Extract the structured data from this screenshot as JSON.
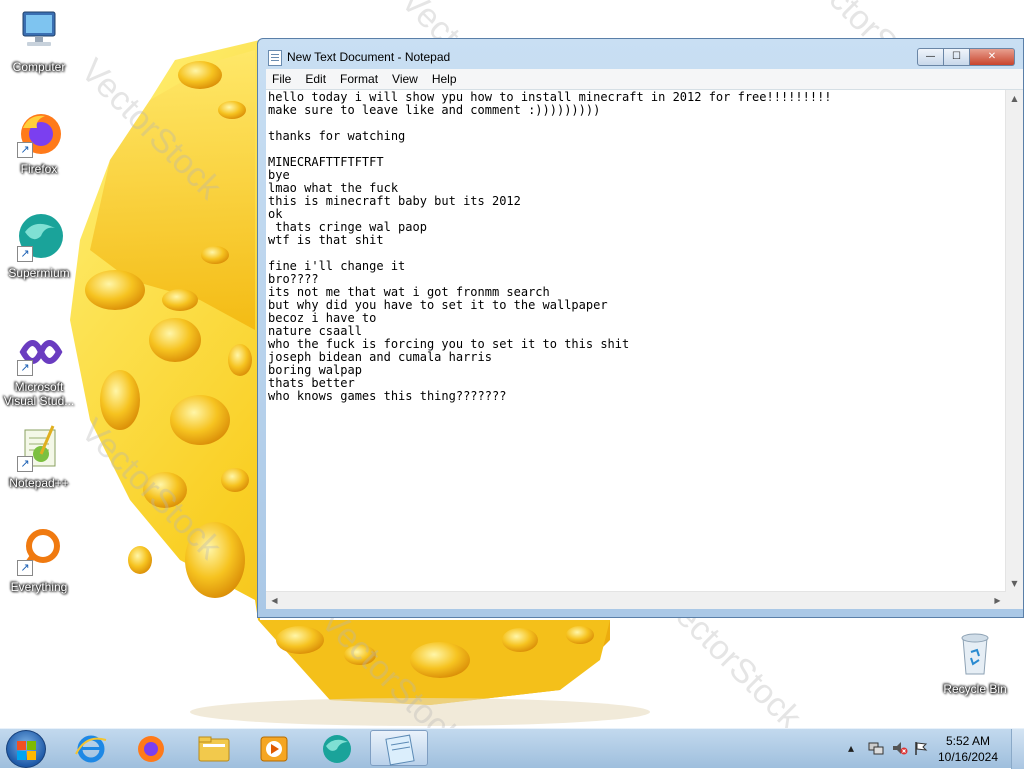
{
  "desktop": {
    "watermark": "VectorStock",
    "icons": [
      {
        "label_lines": [
          "Computer"
        ],
        "icon": "computer-icon"
      },
      {
        "label_lines": [
          "Firefox"
        ],
        "icon": "firefox-icon"
      },
      {
        "label_lines": [
          "Supermium"
        ],
        "icon": "supermium-icon"
      },
      {
        "label_lines": [
          "Microsoft",
          "Visual Stud..."
        ],
        "icon": "visual-studio-icon"
      },
      {
        "label_lines": [
          "Notepad++"
        ],
        "icon": "notepadpp-icon"
      },
      {
        "label_lines": [
          "Everything"
        ],
        "icon": "everything-icon"
      },
      {
        "label_lines": [
          "Recycle Bin"
        ],
        "icon": "recycle-bin-icon"
      }
    ]
  },
  "window": {
    "title": "New Text Document - Notepad",
    "buttons": {
      "minimize": "—",
      "maximize": "☐",
      "close": "✕"
    },
    "menu": [
      "File",
      "Edit",
      "Format",
      "View",
      "Help"
    ],
    "content": "hello today i will show ypu how to install minecraft in 2012 for free!!!!!!!!!\nmake sure to leave like and comment :)))))))))\n\nthanks for watching\n\nMINECRAFTTFTFTFT\nbye\nlmao what the fuck\nthis is minecraft baby but its 2012\nok\n thats cringe wal paop\nwtf is that shit\n\nfine i'll change it\nbro????\nits not me that wat i got fronmm search\nbut why did you have to set it to the wallpaper\nbecoz i have to\nnature csaall\nwho the fuck is forcing you to set it to this shit\njoseph bidean and cumala harris\nboring walpap\nthats better\nwho knows games this thing???????"
  },
  "taskbar": {
    "pinned": [
      "start-orb",
      "internet-explorer-icon",
      "firefox-icon",
      "file-explorer-icon",
      "media-player-icon",
      "supermium-icon",
      "notepad-icon"
    ],
    "active": "notepad-icon",
    "clock_time": "5:52 AM",
    "clock_date": "10/16/2024"
  },
  "colors": {
    "cheese_light": "#ffe45c",
    "cheese_mid": "#f7c61a",
    "cheese_dark": "#e8a30a",
    "window_frame": "#aac8e6",
    "close_button": "#c8442c",
    "taskbar": "#a9c6e2"
  }
}
